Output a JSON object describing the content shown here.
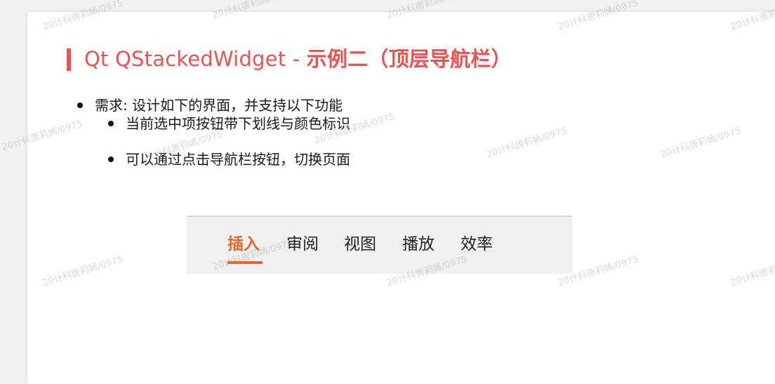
{
  "title": {
    "prefix": "Qt QStackedWidget - ",
    "highlight": "示例二（顶层导航栏）"
  },
  "bullets": [
    "需求: 设计如下的界面，并支持以下功能",
    "当前选中项按钮带下划线与颜色标识",
    "可以通过点击导航栏按钮，切换页面"
  ],
  "nav": {
    "items": [
      "插入",
      "审阅",
      "视图",
      "播放",
      "效率"
    ],
    "active_index": 0
  },
  "colors": {
    "title": "#f0504f",
    "accent": "#e8652c",
    "nav_bg": "#f0f0f0"
  },
  "watermark": "20计科唐莉嫣/0975"
}
